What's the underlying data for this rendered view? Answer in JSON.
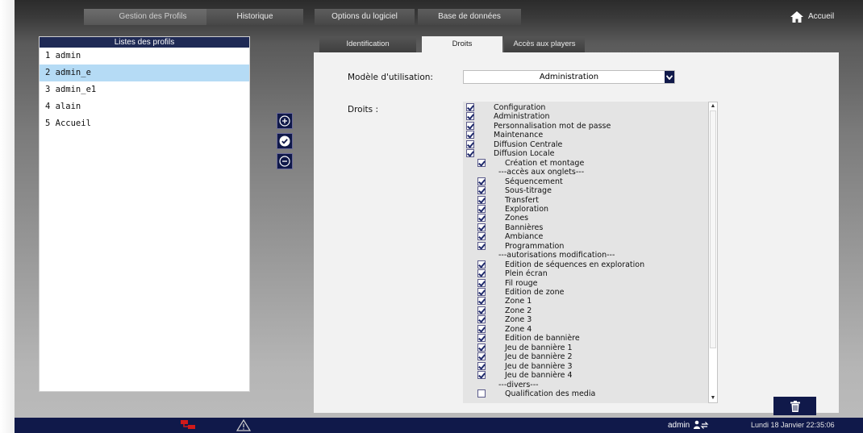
{
  "top_tabs": [
    {
      "label": "Gestion des Profils",
      "active": true
    },
    {
      "label": "Historique",
      "active": false
    },
    {
      "label": "Options du logiciel",
      "active": false
    },
    {
      "label": "Base de données",
      "active": false
    }
  ],
  "home": {
    "label": "Accueil",
    "icon": "home-icon"
  },
  "profiles": {
    "title": "Listes des profils",
    "items": [
      {
        "label": "1 admin",
        "selected": false
      },
      {
        "label": "2 admin_e",
        "selected": true
      },
      {
        "label": "3 admin_e1",
        "selected": false
      },
      {
        "label": "4 alain",
        "selected": false
      },
      {
        "label": "5 Accueil",
        "selected": false
      }
    ]
  },
  "side_buttons": [
    {
      "name": "add-profile-button",
      "icon": "plus-circle-icon"
    },
    {
      "name": "validate-profile-button",
      "icon": "check-circle-icon"
    },
    {
      "name": "remove-profile-button",
      "icon": "minus-circle-icon"
    }
  ],
  "sub_tabs": [
    {
      "label": "Identification",
      "active": false
    },
    {
      "label": "Droits",
      "active": true
    },
    {
      "label": "Accès aux players",
      "active": false
    }
  ],
  "model": {
    "label": "Modèle d'utilisation:",
    "value": "Administration"
  },
  "rights": {
    "label": "Droits :",
    "items": [
      {
        "label": "Configuration",
        "checkbox": true,
        "checked": true,
        "level": 0
      },
      {
        "label": "Administration",
        "checkbox": true,
        "checked": true,
        "level": 0
      },
      {
        "label": "Personnalisation mot de passe",
        "checkbox": true,
        "checked": true,
        "level": 0
      },
      {
        "label": "Maintenance",
        "checkbox": true,
        "checked": true,
        "level": 0
      },
      {
        "label": "Diffusion Centrale",
        "checkbox": true,
        "checked": true,
        "level": 0
      },
      {
        "label": "Diffusion Locale",
        "checkbox": true,
        "checked": true,
        "level": 0
      },
      {
        "label": "Création et montage",
        "checkbox": true,
        "checked": true,
        "level": 1
      },
      {
        "label": "---accès aux onglets---",
        "checkbox": false,
        "checked": false,
        "level": 1
      },
      {
        "label": "Séquencement",
        "checkbox": true,
        "checked": true,
        "level": 1
      },
      {
        "label": "Sous-titrage",
        "checkbox": true,
        "checked": true,
        "level": 1
      },
      {
        "label": "Transfert",
        "checkbox": true,
        "checked": true,
        "level": 1
      },
      {
        "label": "Exploration",
        "checkbox": true,
        "checked": true,
        "level": 1
      },
      {
        "label": "Zones",
        "checkbox": true,
        "checked": true,
        "level": 1
      },
      {
        "label": "Bannières",
        "checkbox": true,
        "checked": true,
        "level": 1
      },
      {
        "label": "Ambiance",
        "checkbox": true,
        "checked": true,
        "level": 1
      },
      {
        "label": "Programmation",
        "checkbox": true,
        "checked": true,
        "level": 1
      },
      {
        "label": "---autorisations modification---",
        "checkbox": false,
        "checked": false,
        "level": 1
      },
      {
        "label": "Edition de séquences en exploration",
        "checkbox": true,
        "checked": true,
        "level": 1
      },
      {
        "label": "Plein écran",
        "checkbox": true,
        "checked": true,
        "level": 1
      },
      {
        "label": "Fil rouge",
        "checkbox": true,
        "checked": true,
        "level": 1
      },
      {
        "label": "Edition de zone",
        "checkbox": true,
        "checked": true,
        "level": 1
      },
      {
        "label": "Zone 1",
        "checkbox": true,
        "checked": true,
        "level": 1
      },
      {
        "label": "Zone 2",
        "checkbox": true,
        "checked": true,
        "level": 1
      },
      {
        "label": "Zone 3",
        "checkbox": true,
        "checked": true,
        "level": 1
      },
      {
        "label": "Zone 4",
        "checkbox": true,
        "checked": true,
        "level": 1
      },
      {
        "label": "Edition de bannière",
        "checkbox": true,
        "checked": true,
        "level": 1
      },
      {
        "label": "Jeu de bannière 1",
        "checkbox": true,
        "checked": true,
        "level": 1
      },
      {
        "label": "Jeu de bannière 2",
        "checkbox": true,
        "checked": true,
        "level": 1
      },
      {
        "label": "Jeu de bannière 3",
        "checkbox": true,
        "checked": true,
        "level": 1
      },
      {
        "label": "Jeu de bannière 4",
        "checkbox": true,
        "checked": true,
        "level": 1
      },
      {
        "label": "---divers---",
        "checkbox": false,
        "checked": false,
        "level": 1
      },
      {
        "label": "Qualification des media",
        "checkbox": true,
        "checked": false,
        "level": 1
      }
    ]
  },
  "status_bar": {
    "user": "admin",
    "datetime": "Lundi 18 Janvier  22:35:06"
  },
  "colors": {
    "navy": "#10194a",
    "header_navy": "#1f2a55",
    "selection": "#b5dbf5"
  }
}
